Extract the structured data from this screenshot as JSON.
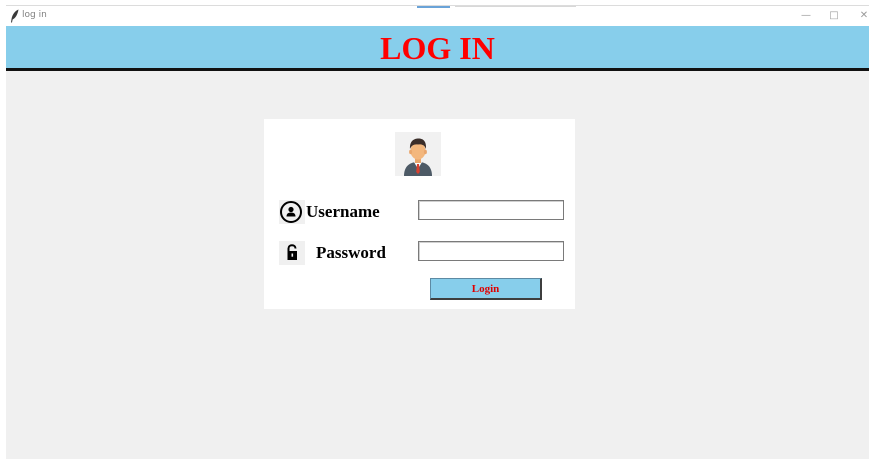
{
  "window": {
    "title": "log in",
    "controls": {
      "minimize": "—",
      "maximize": "□",
      "close": "✕"
    }
  },
  "banner": {
    "title": "LOG IN",
    "background": "#87ceeb",
    "title_color": "#ff0000"
  },
  "form": {
    "avatar_icon": "user-avatar-icon",
    "username": {
      "icon": "user-circle-icon",
      "label": "Username",
      "value": ""
    },
    "password": {
      "icon": "lock-icon",
      "label": "Password",
      "value": ""
    },
    "login_button": {
      "label": "Login",
      "background": "#87ceeb",
      "text_color": "#e00000"
    }
  }
}
